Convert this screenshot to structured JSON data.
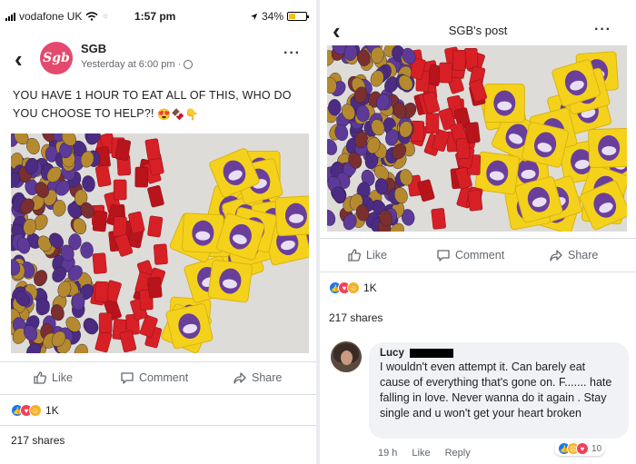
{
  "left": {
    "status": {
      "carrier": "vodafone UK",
      "time": "1:57 pm",
      "battery": "34%"
    },
    "post": {
      "author": "SGB",
      "avatar_text": "Sgb",
      "timestamp": "Yesterday at 6:00 pm ·",
      "caption": "YOU HAVE 1 HOUR TO EAT ALL OF THIS, WHO DO YOU CHOOSE TO HELP?!",
      "caption_emojis": "😍🍫👇"
    },
    "actions": {
      "like": "Like",
      "comment": "Comment",
      "share": "Share"
    },
    "reaction_count": "1K",
    "shares": "217 shares"
  },
  "right": {
    "header_title": "SGB's post",
    "actions": {
      "like": "Like",
      "comment": "Comment",
      "share": "Share"
    },
    "reaction_count": "1K",
    "shares": "217 shares",
    "comment": {
      "author": "Lucy",
      "text": "I wouldn't even attempt it. Can barely eat cause of everything that's gone on. F....... hate falling in love. Never wanna do it again . Stay single and u won't get your heart broken",
      "time": "19 h",
      "like": "Like",
      "reply": "Reply",
      "reaction_count": "10"
    }
  },
  "colors": {
    "facebook_blue": "#1877f2",
    "love_red": "#f33e58",
    "haha_yellow": "#f7b125",
    "egg_purple": "#4b2c82",
    "wrapper_red": "#d71f26",
    "minieggs_yellow": "#f4d21c"
  },
  "icons": [
    "back-chevron-icon",
    "more-dots-icon",
    "globe-icon",
    "like-thumb-icon",
    "comment-bubble-icon",
    "share-arrow-icon",
    "wifi-icon",
    "location-arrow-icon",
    "battery-icon"
  ]
}
